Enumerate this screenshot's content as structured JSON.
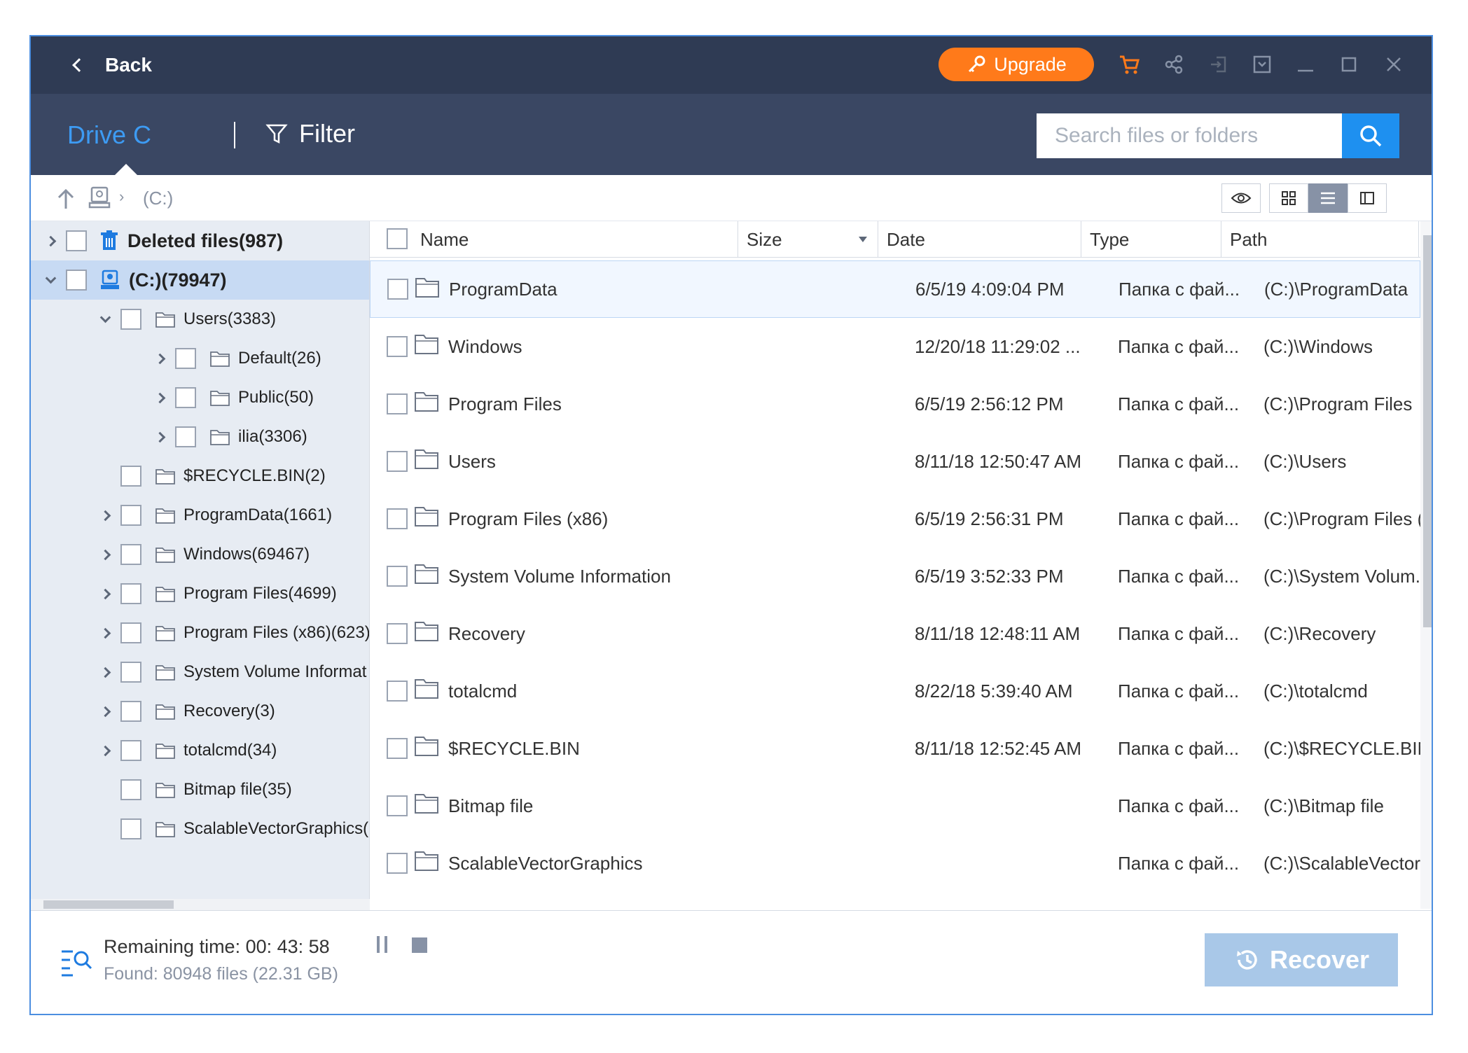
{
  "titlebar": {
    "back_label": "Back",
    "upgrade_label": "Upgrade",
    "accent_color": "#ff7a1a",
    "icons": [
      "cart-icon",
      "share-icon",
      "login-icon",
      "dropdown-icon",
      "minimize-icon",
      "maximize-icon",
      "close-icon"
    ]
  },
  "drivebar": {
    "title": "Drive C",
    "filter_label": "Filter",
    "search_placeholder": "Search files or folders"
  },
  "path": {
    "label": "(C:)"
  },
  "tree": [
    {
      "label": "Deleted files(987)"
    },
    {
      "label": "(C:)(79947)"
    },
    {
      "label": "Users(3383)"
    },
    {
      "label": "Default(26)"
    },
    {
      "label": "Public(50)"
    },
    {
      "label": "ilia(3306)"
    },
    {
      "label": "$RECYCLE.BIN(2)"
    },
    {
      "label": "ProgramData(1661)"
    },
    {
      "label": "Windows(69467)"
    },
    {
      "label": "Program Files(4699)"
    },
    {
      "label": "Program Files (x86)(623)"
    },
    {
      "label": "System Volume Informat"
    },
    {
      "label": "Recovery(3)"
    },
    {
      "label": "totalcmd(34)"
    },
    {
      "label": "Bitmap file(35)"
    },
    {
      "label": "ScalableVectorGraphics("
    }
  ],
  "columns": {
    "name": "Name",
    "size": "Size",
    "date": "Date",
    "type": "Type",
    "path": "Path"
  },
  "files": [
    {
      "name": "ProgramData",
      "size": "",
      "date": "6/5/19 4:09:04 PM",
      "type": "Папка с фай...",
      "path": "(C:)\\ProgramData"
    },
    {
      "name": "Windows",
      "size": "",
      "date": "12/20/18 11:29:02 ...",
      "type": "Папка с фай...",
      "path": "(C:)\\Windows"
    },
    {
      "name": "Program Files",
      "size": "",
      "date": "6/5/19 2:56:12 PM",
      "type": "Папка с фай...",
      "path": "(C:)\\Program Files"
    },
    {
      "name": "Users",
      "size": "",
      "date": "8/11/18 12:50:47 AM",
      "type": "Папка с фай...",
      "path": "(C:)\\Users"
    },
    {
      "name": "Program Files (x86)",
      "size": "",
      "date": "6/5/19 2:56:31 PM",
      "type": "Папка с фай...",
      "path": "(C:)\\Program Files (..."
    },
    {
      "name": "System Volume Information",
      "size": "",
      "date": "6/5/19 3:52:33 PM",
      "type": "Папка с фай...",
      "path": "(C:)\\System Volum..."
    },
    {
      "name": "Recovery",
      "size": "",
      "date": "8/11/18 12:48:11 AM",
      "type": "Папка с фай...",
      "path": "(C:)\\Recovery"
    },
    {
      "name": "totalcmd",
      "size": "",
      "date": "8/22/18 5:39:40 AM",
      "type": "Папка с фай...",
      "path": "(C:)\\totalcmd"
    },
    {
      "name": "$RECYCLE.BIN",
      "size": "",
      "date": "8/11/18 12:52:45 AM",
      "type": "Папка с фай...",
      "path": "(C:)\\$RECYCLE.BIN"
    },
    {
      "name": "Bitmap file",
      "size": "",
      "date": "",
      "type": "Папка с фай...",
      "path": "(C:)\\Bitmap file"
    },
    {
      "name": "ScalableVectorGraphics",
      "size": "",
      "date": "",
      "type": "Папка с фай...",
      "path": "(C:)\\ScalableVector..."
    }
  ],
  "status": {
    "remaining": "Remaining time: 00: 43: 58",
    "found": "Found: 80948 files (22.31 GB)",
    "recover_label": "Recover"
  }
}
